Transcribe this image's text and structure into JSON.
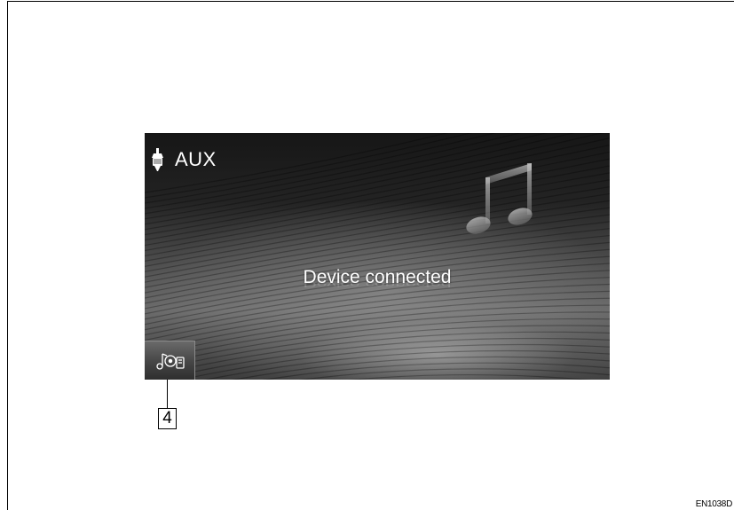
{
  "screen": {
    "title": "AUX",
    "status": "Device connected",
    "header_icon": "aux-plug-icon",
    "background_icon": "music-note-icon",
    "source_button_icon": "media-source-icon"
  },
  "callout": {
    "number": "4"
  },
  "figure_code": "EN1038D",
  "colors": {
    "screen_dark": "#161616",
    "text": "#ffffff"
  }
}
